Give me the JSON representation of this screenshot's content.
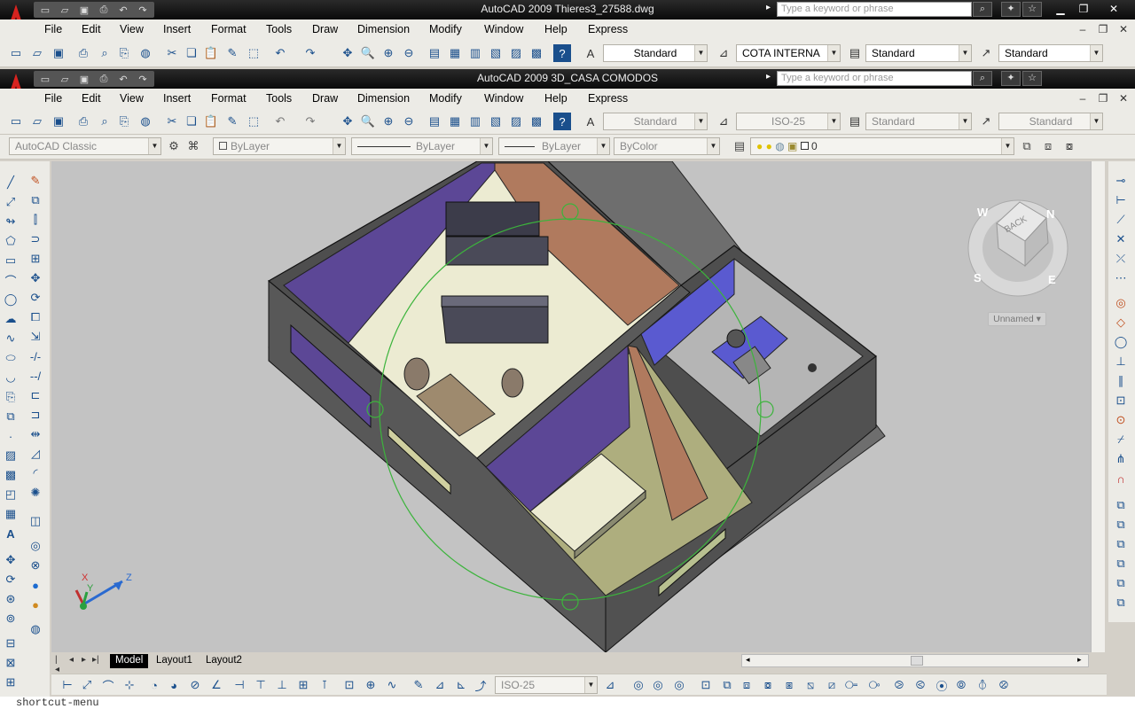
{
  "window_back": {
    "title": "AutoCAD 2009  Thieres3_27588.dwg",
    "search_placeholder": "Type a keyword or phrase",
    "menus": [
      "File",
      "Edit",
      "View",
      "Insert",
      "Format",
      "Tools",
      "Draw",
      "Dimension",
      "Modify",
      "Window",
      "Help",
      "Express"
    ],
    "styles": {
      "text_style": "Standard",
      "dim_style": "COTA INTERNA",
      "table_style": "Standard",
      "mleader_style": "Standard"
    }
  },
  "window_front": {
    "title": "AutoCAD 2009  3D_CASA COMODOS",
    "search_placeholder": "Type a keyword or phrase",
    "menus": [
      "File",
      "Edit",
      "View",
      "Insert",
      "Format",
      "Tools",
      "Draw",
      "Dimension",
      "Modify",
      "Window",
      "Help",
      "Express"
    ],
    "styles": {
      "text_style": "Standard",
      "dim_style": "ISO-25",
      "table_style": "Standard",
      "mleader_style": "Standard"
    }
  },
  "properties_bar": {
    "workspace": "AutoCAD Classic",
    "color": "ByLayer",
    "linetype": "ByLayer",
    "lineweight": "ByLayer",
    "plotstyle": "ByColor",
    "layer": "0"
  },
  "viewcube": {
    "face_label": "BACK",
    "compass": {
      "n": "N",
      "s": "S",
      "e": "E",
      "w": "W"
    },
    "ucs_menu": "Unnamed"
  },
  "ucs_icon": {
    "x": "X",
    "y": "Y",
    "z": "Z"
  },
  "layout_tabs": [
    "Model",
    "Layout1",
    "Layout2"
  ],
  "status": {
    "dim_style": "ISO-25"
  },
  "command_line": "shortcut-menu",
  "colors": {
    "viewport_bg": "#c3c3c3",
    "orbit_circle": "#3cb43c",
    "wall_purple": "#5c4796",
    "wall_terracotta": "#b07a5e",
    "floor_cream": "#ecebd2",
    "floor_olive": "#aeae7e",
    "wall_gray": "#5a5a5a"
  }
}
